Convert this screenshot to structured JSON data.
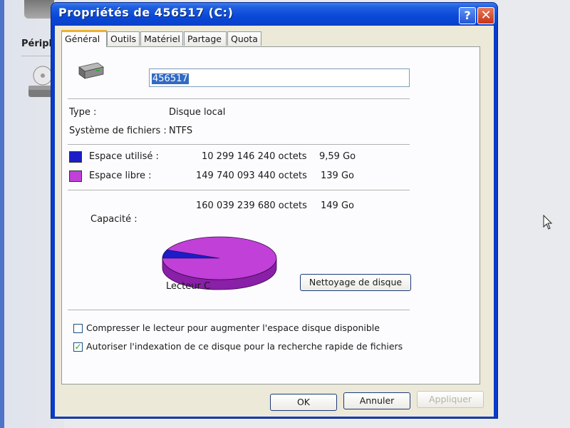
{
  "background": {
    "explorer_label": "Périph"
  },
  "window": {
    "title": "Propriétés de 456517 (C:)",
    "help_glyph": "?",
    "close_glyph": "✕"
  },
  "tabs": [
    {
      "label": "Général",
      "active": true
    },
    {
      "label": "Outils",
      "active": false
    },
    {
      "label": "Matériel",
      "active": false
    },
    {
      "label": "Partage",
      "active": false
    },
    {
      "label": "Quota",
      "active": false
    }
  ],
  "general": {
    "drive_icon": "hard-drive-icon",
    "volume_name": "456517",
    "type_label": "Type :",
    "type_value": "Disque local",
    "fs_label": "Système de fichiers :",
    "fs_value": "NTFS",
    "used_label": "Espace utilisé :",
    "used_bytes": "10 299 146 240 octets",
    "used_size": "9,59 Go",
    "free_label": "Espace libre :",
    "free_bytes": "149 740 093 440 octets",
    "free_size": "139 Go",
    "capacity_label": "Capacité :",
    "capacity_bytes": "160 039 239 680 octets",
    "capacity_size": "149 Go",
    "drive_label": "Lecteur C",
    "cleanup_button": "Nettoyage de disque",
    "compress_label": "Compresser le lecteur pour augmenter l'espace disque disponible",
    "compress_checked": false,
    "index_label": "Autoriser l'indexation de ce disque pour la recherche rapide de fichiers",
    "index_checked": true
  },
  "colors": {
    "used": "#1c1cc8",
    "free": "#c040d8"
  },
  "chart_data": {
    "type": "pie",
    "categories": [
      "Espace utilisé",
      "Espace libre"
    ],
    "values": [
      10299146240,
      149740093440
    ]
  },
  "footer": {
    "ok": "OK",
    "cancel": "Annuler",
    "apply": "Appliquer"
  }
}
